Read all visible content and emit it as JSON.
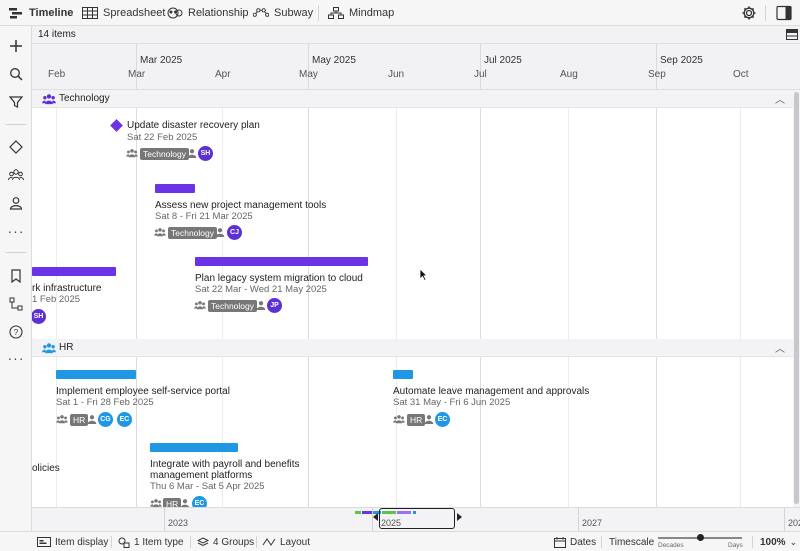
{
  "tabs": [
    {
      "label": "Timeline",
      "icon": "timeline-icon"
    },
    {
      "label": "Spreadsheet",
      "icon": "spreadsheet-icon"
    },
    {
      "label": "Relationship",
      "icon": "relationship-icon"
    },
    {
      "label": "Subway",
      "icon": "subway-icon"
    },
    {
      "label": "Mindmap",
      "icon": "mindmap-icon"
    }
  ],
  "item_count": "14 items",
  "quarters": [
    "Mar 2025",
    "May 2025",
    "Jul 2025",
    "Sep 2025"
  ],
  "months": [
    "Feb",
    "Mar",
    "Apr",
    "May",
    "Jun",
    "Jul",
    "Aug",
    "Sep",
    "Oct"
  ],
  "groups": [
    {
      "label": "Technology",
      "items": [
        {
          "title": "Update disaster recovery plan",
          "dates": "Sat 22 Feb 2025",
          "tag": "Technology",
          "avatar": "SH",
          "milestone": true
        },
        {
          "title": "Assess new project management tools",
          "dates": "Sat 8 - Fri 21 Mar 2025",
          "tag": "Technology",
          "avatar": "CJ"
        },
        {
          "title": "Plan legacy system migration to cloud",
          "dates": "Sat 22 Mar - Wed 21 May 2025",
          "tag": "Technology",
          "avatar": "JP"
        },
        {
          "title": "rk infrastructure",
          "dates": "1 Feb 2025",
          "avatar": "SH"
        }
      ]
    },
    {
      "label": "HR",
      "items": [
        {
          "title": "Implement employee self-service portal",
          "dates": "Sat 1 - Fri 28 Feb 2025",
          "tag": "HR",
          "avatars": [
            "CG",
            "EC"
          ]
        },
        {
          "title": "Automate leave management and approvals",
          "dates": "Sat 31 May - Fri 6 Jun 2025",
          "tag": "HR",
          "avatars": [
            "EC"
          ]
        },
        {
          "title_line1": "Integrate with payroll and benefits",
          "title_line2": "management platforms",
          "dates": "Thu 6 Mar - Sat 5 Apr 2025",
          "tag": "HR",
          "avatars": [
            "EC"
          ]
        },
        {
          "title": "olicies"
        }
      ]
    }
  ],
  "overview_years": [
    "2023",
    "2025",
    "2027",
    "202"
  ],
  "status": {
    "item_display": "Item display",
    "item_type": "1 Item type",
    "groups": "4 Groups",
    "layout": "Layout",
    "dates": "Dates",
    "timescale": "Timescale",
    "decades": "Decades",
    "days": "Days",
    "zoom": "100%"
  },
  "colors": {
    "purple": "#6a34e6",
    "blue": "#1f97e4",
    "group_icon": "#5b31d6"
  }
}
